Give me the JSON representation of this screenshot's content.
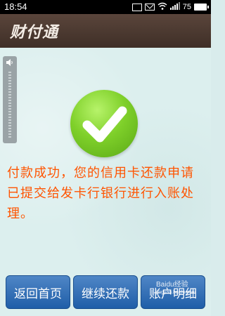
{
  "status_bar": {
    "time": "18:54",
    "battery_level": "75"
  },
  "header": {
    "logo_text": "财付通"
  },
  "main": {
    "message": "付款成功，您的信用卡还款申请已提交给发卡行银行进行入账处理。"
  },
  "buttons": {
    "home_label": "返回首页",
    "continue_label": "继续还款",
    "details_label": "账户明细"
  },
  "watermark": {
    "text": "Baidu经验",
    "url": "jingyan.baidu.com"
  },
  "colors": {
    "header_bg": "#4e3b32",
    "content_bg": "#dcefee",
    "message_text": "#ff5400",
    "button_bg": "#2f6db5",
    "check_green": "#7fd02a"
  },
  "icons": {
    "status": [
      "image-icon",
      "mail-icon",
      "wifi-icon",
      "signal-icon",
      "battery-icon"
    ],
    "volume": "speaker-icon",
    "success": "checkmark-icon"
  }
}
